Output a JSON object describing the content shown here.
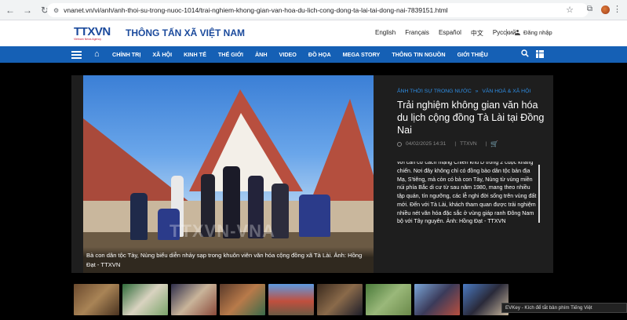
{
  "browser": {
    "url": "vnanet.vn/vi/anh/anh-thoi-su-trong-nuoc-1014/trai-nghiem-khong-gian-van-hoa-du-lich-cong-dong-ta-lai-tai-dong-nai-7839151.html"
  },
  "header": {
    "logo_text": "TTXVN",
    "logo_subtext": "Vietnam News Agency",
    "site_name": "THÔNG TẤN XÃ VIỆT NAM",
    "languages": [
      "English",
      "Français",
      "Español",
      "中文",
      "Русский"
    ],
    "login_label": "Đăng nhập"
  },
  "nav": {
    "items": [
      "CHÍNH TRỊ",
      "XÃ HỘI",
      "KINH TẾ",
      "THẾ GIỚI",
      "ẢNH",
      "VIDEO",
      "ĐỒ HỌA",
      "MEGA STORY",
      "THÔNG TIN NGUỒN",
      "GIỚI THIỆU"
    ]
  },
  "article": {
    "breadcrumb_1": "ẢNH THỜI SỰ TRONG NƯỚC",
    "breadcrumb_sep": "»",
    "breadcrumb_2": "VĂN HOÁ & XÃ HỘI",
    "title": "Trải nghiệm không gian văn hóa du lịch cộng đồng Tà Lài tại Đồng Nai",
    "date": "04/02/2025 14:31",
    "source": "TTXVN",
    "watermark": "TTXVN-VNA",
    "photo_caption": "Bà con dân tộc Tày, Nùng biểu diễn nhảy sạp trong khuôn viên văn hóa cộng đồng xã Tà Lài. Ảnh: Hồng Đạt - TTXVN",
    "description": "với căn cứ cách mạng Chiến khu D trong 2 cuộc kháng chiến. Nơi đây không chỉ có đồng bào dân tộc bản địa Mạ, S'tiêng, mà còn có bà con Tày, Nùng từ vùng miền núi phía Bắc di cư từ sau năm 1980, mang theo nhiều tập quán, tín ngưỡng, các lễ nghi đời sống trên vùng đất mới. Đến với Tà Lài, khách tham quan được trải nghiệm nhiều nét văn hóa đặc sắc ở vùng giáp ranh Đông Nam bộ với Tây nguyên. Ảnh: Hồng Đạt - TTXVN"
  },
  "evkey": "EVKey - Kích để tắt bản phím Tiếng Việt",
  "colors": {
    "nav_blue": "#1560b5",
    "link_blue": "#2f8fe6",
    "brand_blue": "#1b4a9c"
  }
}
